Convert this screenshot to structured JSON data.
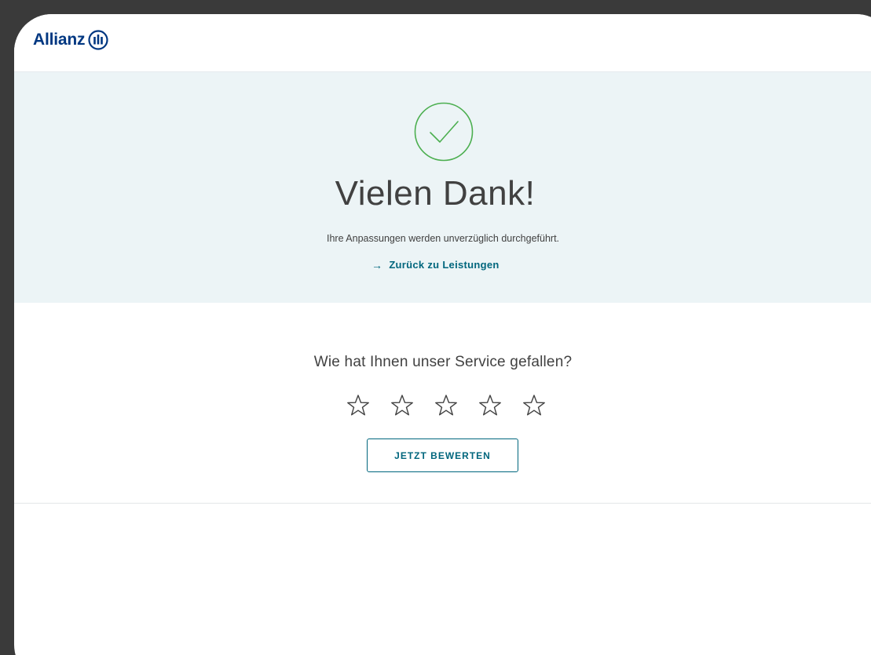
{
  "header": {
    "brand_name": "Allianz",
    "brand_color": "#003781",
    "logo_icon": "allianz-eagle-icon"
  },
  "confirmation": {
    "icon": "checkmark-circle-icon",
    "icon_color": "#4caf50",
    "title": "Vielen Dank!",
    "subtitle": "Ihre Anpassungen werden unverzüglich durchgeführt.",
    "back_link_icon": "arrow-right-icon",
    "back_link_label": "Zurück zu Leistungen",
    "background_color": "#ecf4f6"
  },
  "feedback": {
    "question": "Wie hat Ihnen unser Service gefallen?",
    "stars": [
      {
        "icon": "star-outline-icon"
      },
      {
        "icon": "star-outline-icon"
      },
      {
        "icon": "star-outline-icon"
      },
      {
        "icon": "star-outline-icon"
      },
      {
        "icon": "star-outline-icon"
      }
    ],
    "selected_rating": 0,
    "max_rating": 5,
    "submit_label": "JETZT BEWERTEN",
    "accent_color": "#00667d"
  }
}
